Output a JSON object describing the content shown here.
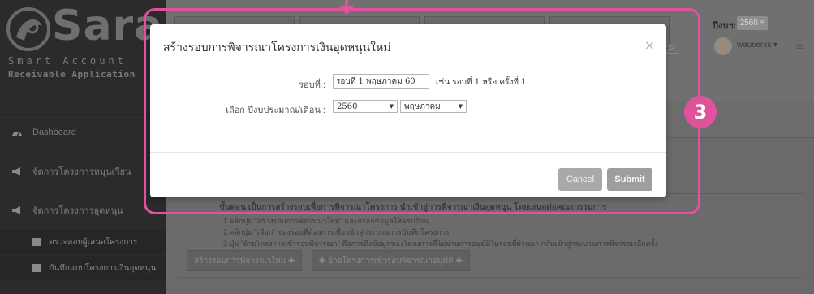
{
  "logo": {
    "title": "Sara",
    "line1": "Smart Account",
    "line2": "Receivable Application"
  },
  "sidebar": {
    "items": [
      {
        "label": "Dashboard",
        "icon": "dashboard-icon"
      },
      {
        "label": "จัดการโครงการหมุนเวียน",
        "icon": "megaphone-icon"
      },
      {
        "label": "จัดการโครงการอุดหนุน",
        "icon": "megaphone-icon"
      }
    ],
    "subitems": [
      {
        "label": "ตรวจสอบผู้เสนอโครงการ",
        "icon": "user-icon"
      },
      {
        "label": "บันทึกแบบโครงการเงินอุดหนุน",
        "icon": "book-icon"
      }
    ]
  },
  "header": {
    "budget_label": "ปีงบฯ:",
    "budget_year": "2560",
    "username": "wauserxx"
  },
  "background_panel": {
    "bold_line": "ขั้นตอน เป็นการสร้างรอบเพื่อการพิจารณาโครงการ นำเข้าสู่การพิจารณาเงินอุดหนุน โดยเสนอต่อคณะกรรมการ",
    "lines": [
      "1.คลิกปุ่ม \"สร้างรอบการพิจารณาใหม่\" และกรอกข้อมูลให้ครบถ้วน",
      "2.คลิกปุ่ม \"เลือก\" ของรอบที่ต้องการเพื่อ เข้าสู่กระบวนการบันทึกโครงการ",
      "3.ปุ่ม \"ย้ายโครงการเข้ารอบพิจารณา\" คือการดึงข้อมูลของโครงการที่ไม่ผ่านการอนุมัติในรอบที่ผ่านมา กลับเข้าสู่กระบวนการพิจารณาอีกครั้ง"
    ],
    "btn_new_round": "สร้างรอบการพิจารณาใหม่ ✚",
    "btn_move_project": "✚ ย้ายโครงการเข้ารอบพิจารณาอนุมัติ ✚"
  },
  "modal": {
    "title": "สร้างรอบการพิจารณาโครงการเงินอุดหนุนใหม่",
    "close": "×",
    "round_label": "รอบที่ :",
    "round_value": "รอบที่ 1 พฤษภาคม 60",
    "round_hint": "เช่น รอบที่ 1 หรือ ครั้งที่ 1",
    "select_label": "เลือก ปีงบประมาณ/เดือน :",
    "year_selected": "2560",
    "month_selected": "พฤษภาคม",
    "cancel": "Cancel",
    "submit": "Submit"
  },
  "annotation": {
    "step_number": "3",
    "color": "#e0529c"
  }
}
